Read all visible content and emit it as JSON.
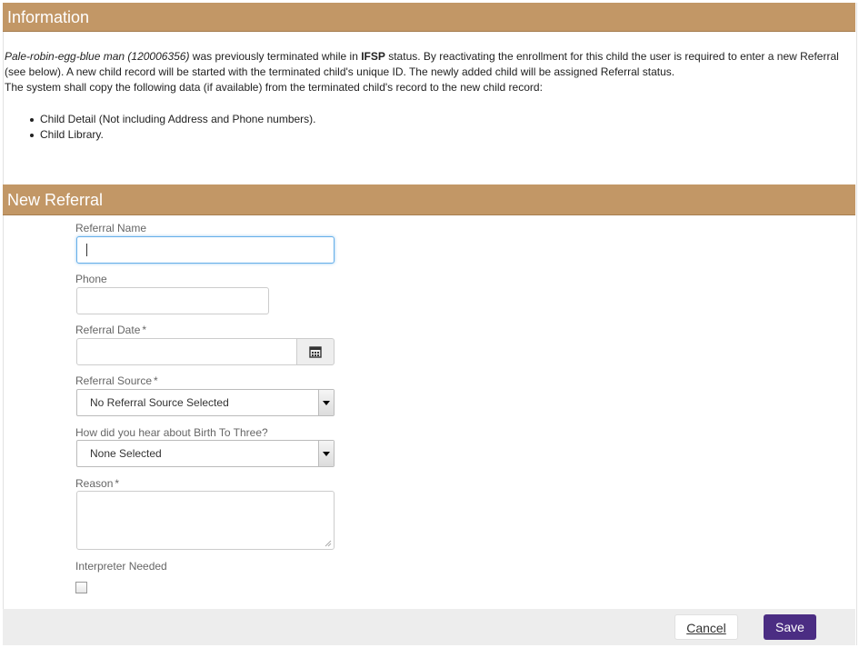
{
  "information": {
    "title": "Information",
    "child_name": "Pale-robin-egg-blue man (120006356)",
    "text_part1": " was previously terminated while in ",
    "status": "IFSP",
    "text_part2": " status. By reactivating the enrollment for this child the user is required to enter a new Referral (see below). A new child record will be started with the terminated child's unique ID. The newly added child will be assigned Referral status.",
    "copy_text": "The system shall copy the following data (if available) from the terminated child's record to the new child record:",
    "copy_items": [
      "Child Detail (Not including Address and Phone numbers).",
      "Child Library."
    ]
  },
  "referral": {
    "title": "New Referral",
    "name_label": "Referral Name",
    "name_value": "",
    "phone_label": "Phone",
    "phone_value": "",
    "date_label": "Referral Date",
    "date_value": "",
    "source_label": "Referral Source",
    "source_value": "No Referral Source Selected",
    "hear_label": "How did you hear about Birth To Three?",
    "hear_value": "None Selected",
    "reason_label": "Reason",
    "reason_value": "",
    "interpreter_label": "Interpreter Needed",
    "interpreter_checked": false,
    "required_marker": "*"
  },
  "footer": {
    "cancel_label": "Cancel",
    "save_label": "Save"
  },
  "colors": {
    "header": "#c29766",
    "save_button": "#4b2d83"
  },
  "icons": {
    "date_picker": "calendar-icon",
    "dropdown": "chevron-down-icon"
  }
}
